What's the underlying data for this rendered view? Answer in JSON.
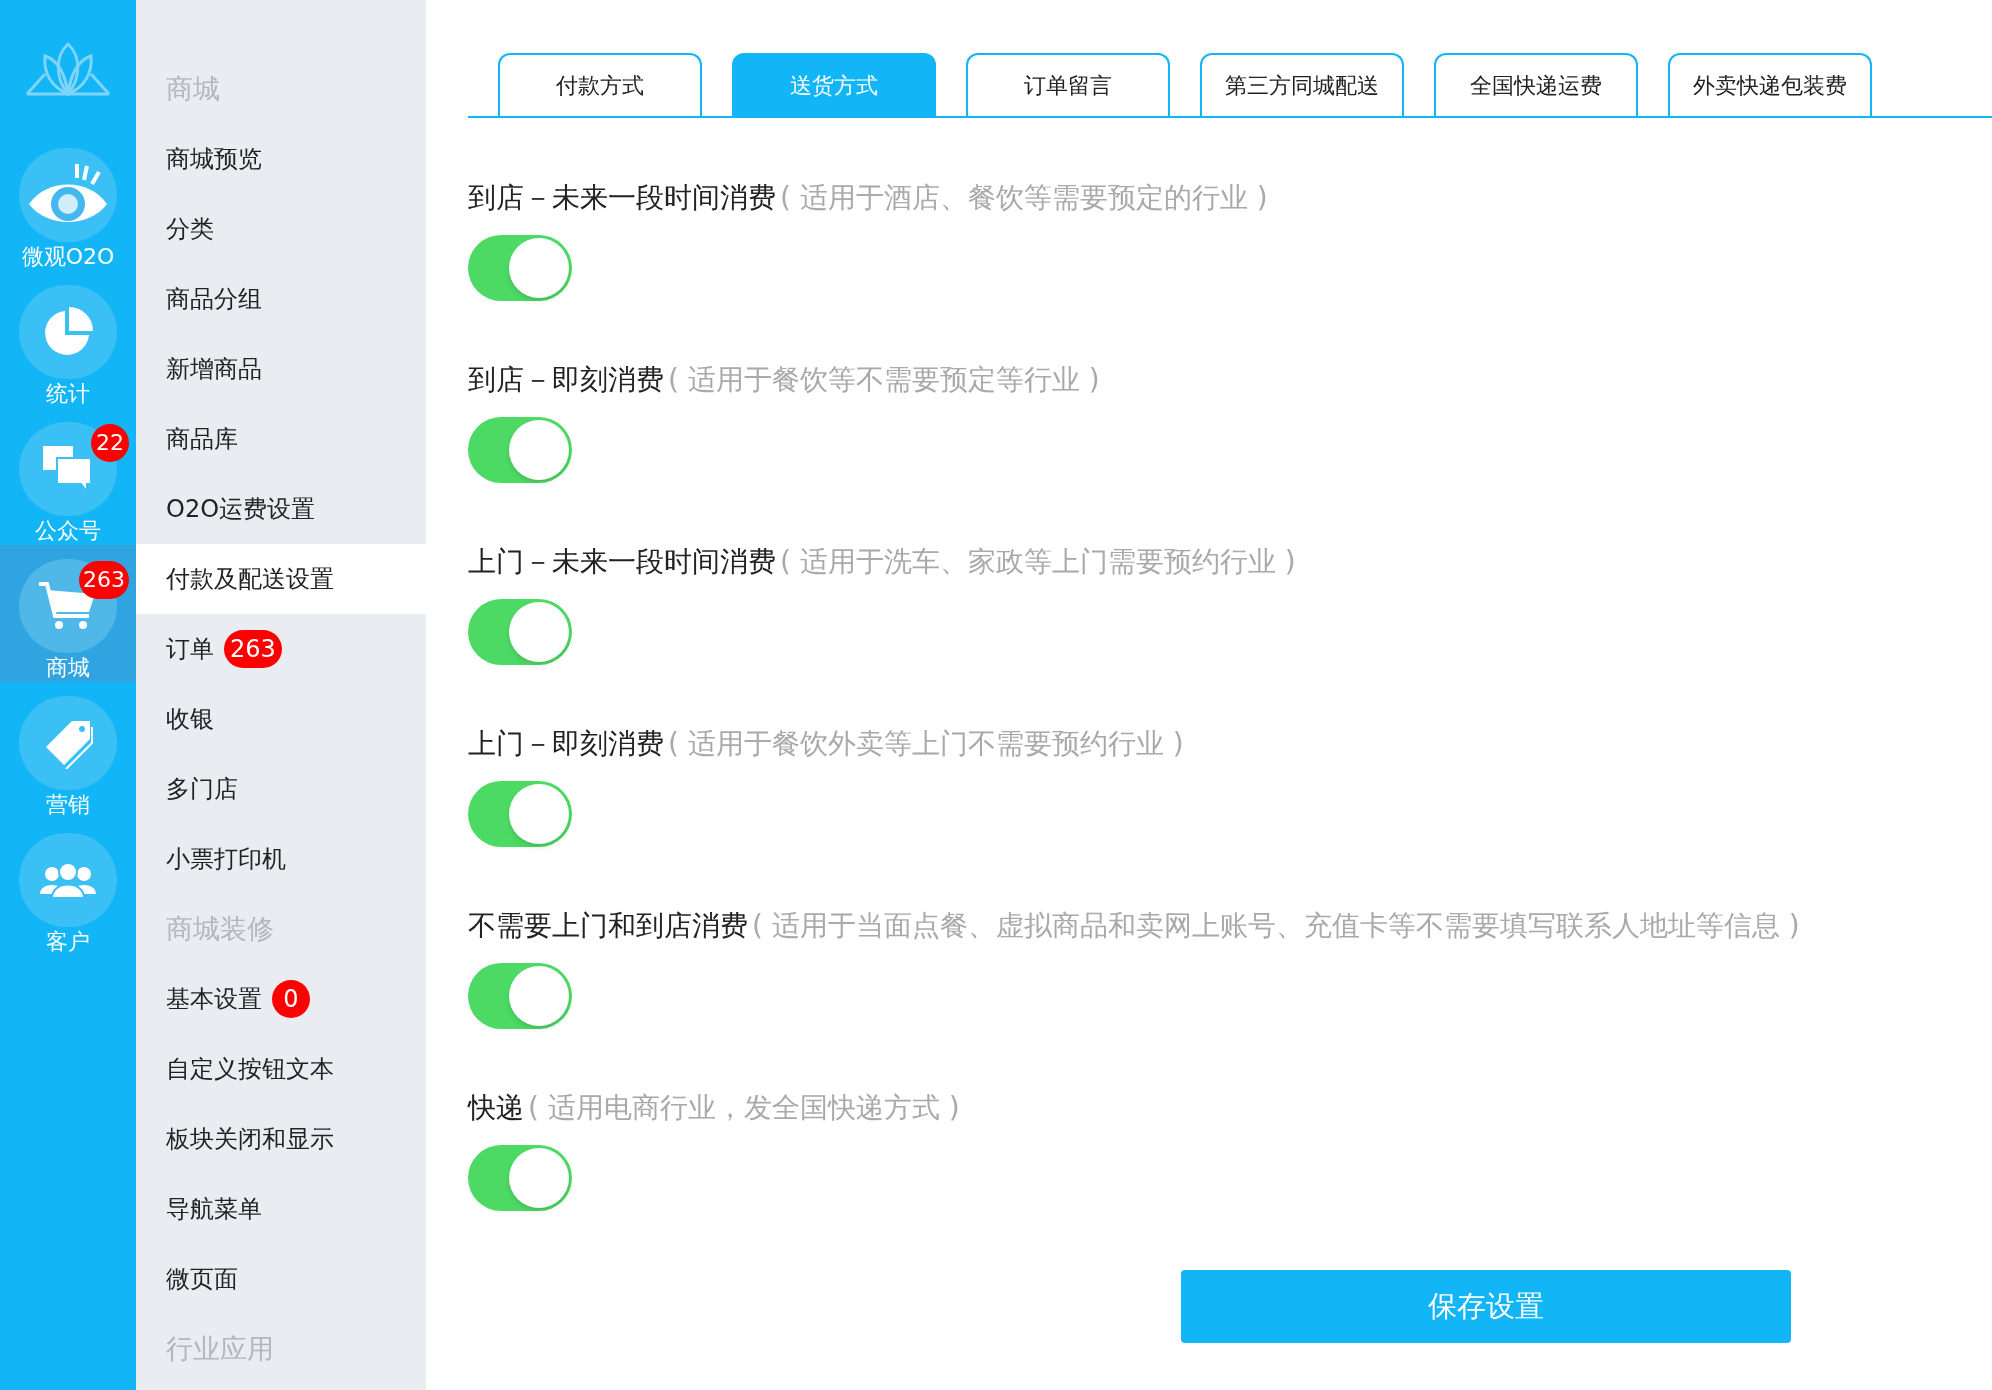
{
  "rail": [
    {
      "label": "微观O2O",
      "selected": false
    },
    {
      "label": "统计",
      "selected": false
    },
    {
      "label": "公众号",
      "badge": "22",
      "selected": false
    },
    {
      "label": "商城",
      "badge": "263",
      "selected": true
    },
    {
      "label": "营销",
      "selected": false
    },
    {
      "label": "客户",
      "selected": false
    }
  ],
  "submenu": [
    {
      "kind": "header",
      "label": "商城"
    },
    {
      "kind": "item",
      "label": "商城预览",
      "selected": false
    },
    {
      "kind": "item",
      "label": "分类",
      "selected": false
    },
    {
      "kind": "item",
      "label": "商品分组",
      "selected": false
    },
    {
      "kind": "item",
      "label": "新增商品",
      "selected": false
    },
    {
      "kind": "item",
      "label": "商品库",
      "selected": false
    },
    {
      "kind": "item",
      "label": "O2O运费设置",
      "selected": false
    },
    {
      "kind": "item",
      "label": "付款及配送设置",
      "selected": true
    },
    {
      "kind": "item",
      "label": "订单",
      "badge": "263",
      "selected": false
    },
    {
      "kind": "item",
      "label": "收银",
      "selected": false
    },
    {
      "kind": "item",
      "label": "多门店",
      "selected": false
    },
    {
      "kind": "item",
      "label": "小票打印机",
      "selected": false
    },
    {
      "kind": "header",
      "label": "商城装修"
    },
    {
      "kind": "item",
      "label": "基本设置",
      "badge": "0",
      "selected": false
    },
    {
      "kind": "item",
      "label": "自定义按钮文本",
      "selected": false
    },
    {
      "kind": "item",
      "label": "板块关闭和显示",
      "selected": false
    },
    {
      "kind": "item",
      "label": "导航菜单",
      "selected": false
    },
    {
      "kind": "item",
      "label": "微页面",
      "selected": false
    },
    {
      "kind": "header",
      "label": "行业应用"
    }
  ],
  "tabs": [
    {
      "label": "付款方式",
      "selected": false
    },
    {
      "label": "送货方式",
      "selected": true
    },
    {
      "label": "订单留言",
      "selected": false
    },
    {
      "label": "第三方同城配送",
      "selected": false
    },
    {
      "label": "全国快递运费",
      "selected": false
    },
    {
      "label": "外卖快递包装费",
      "selected": false
    }
  ],
  "options": [
    {
      "title": "到店－未来一段时间消费",
      "hint": "( 适用于酒店、餐饮等需要预定的行业 )",
      "on": true
    },
    {
      "title": "到店－即刻消费",
      "hint": "( 适用于餐饮等不需要预定等行业 )",
      "on": true
    },
    {
      "title": "上门－未来一段时间消费",
      "hint": "( 适用于洗车、家政等上门需要预约行业 )",
      "on": true
    },
    {
      "title": "上门－即刻消费",
      "hint": "( 适用于餐饮外卖等上门不需要预约行业 )",
      "on": true
    },
    {
      "title": "不需要上门和到店消费",
      "hint": "( 适用于当面点餐、虚拟商品和卖网上账号、充值卡等不需要填写联系人地址等信息 )",
      "on": true
    },
    {
      "title": "快递",
      "hint": "( 适用电商行业，发全国快递方式 )",
      "on": true
    }
  ],
  "save_button": "保存设置"
}
